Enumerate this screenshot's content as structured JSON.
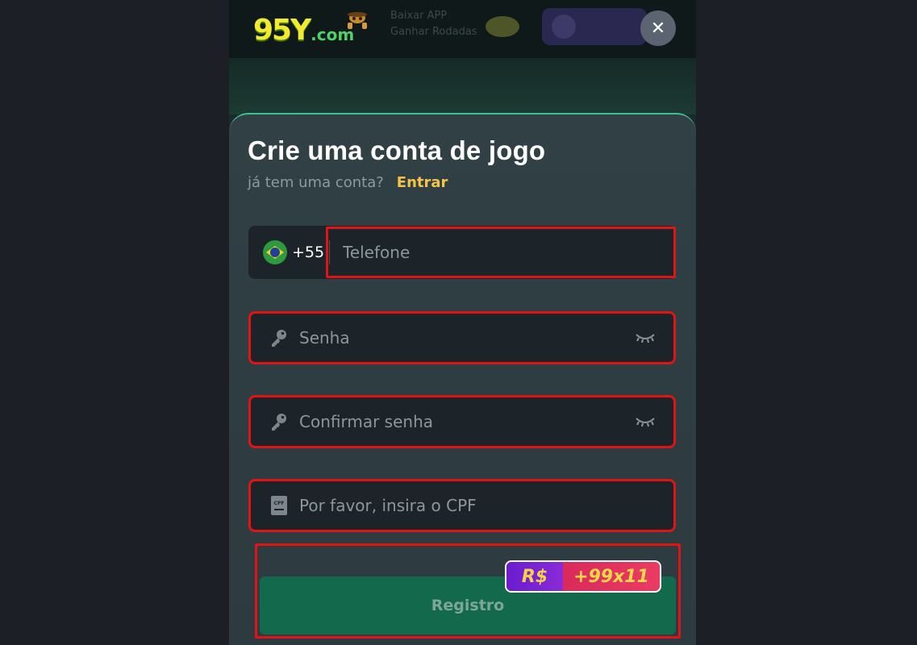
{
  "brand": {
    "logo_main": "95Y",
    "logo_suffix": ".com"
  },
  "background": {
    "promo_line1": "Baixar APP",
    "promo_line2": "Ganhar Rodadas"
  },
  "modal": {
    "close_symbol": "✕",
    "title": "Crie uma conta de jogo",
    "subtitle": "já tem uma conta?",
    "login_link": "Entrar",
    "phone": {
      "country_flag": "brazil-flag-icon",
      "dial_code": "+55",
      "placeholder": "Telefone"
    },
    "password": {
      "placeholder": "Senha",
      "icon": "key-icon",
      "toggle_icon": "eye-closed-icon"
    },
    "confirm_password": {
      "placeholder": "Confirmar senha",
      "icon": "key-icon",
      "toggle_icon": "eye-closed-icon"
    },
    "cpf": {
      "placeholder": "Por favor, insira o CPF",
      "icon": "cpf-card-icon"
    },
    "register": {
      "label": "Registro",
      "bonus_currency": "R$",
      "bonus_value": "+99x11"
    }
  },
  "colors": {
    "accent": "#3fbf96",
    "link": "#f3c34a",
    "highlight": "#e01414",
    "register_bg": "#12694c"
  }
}
